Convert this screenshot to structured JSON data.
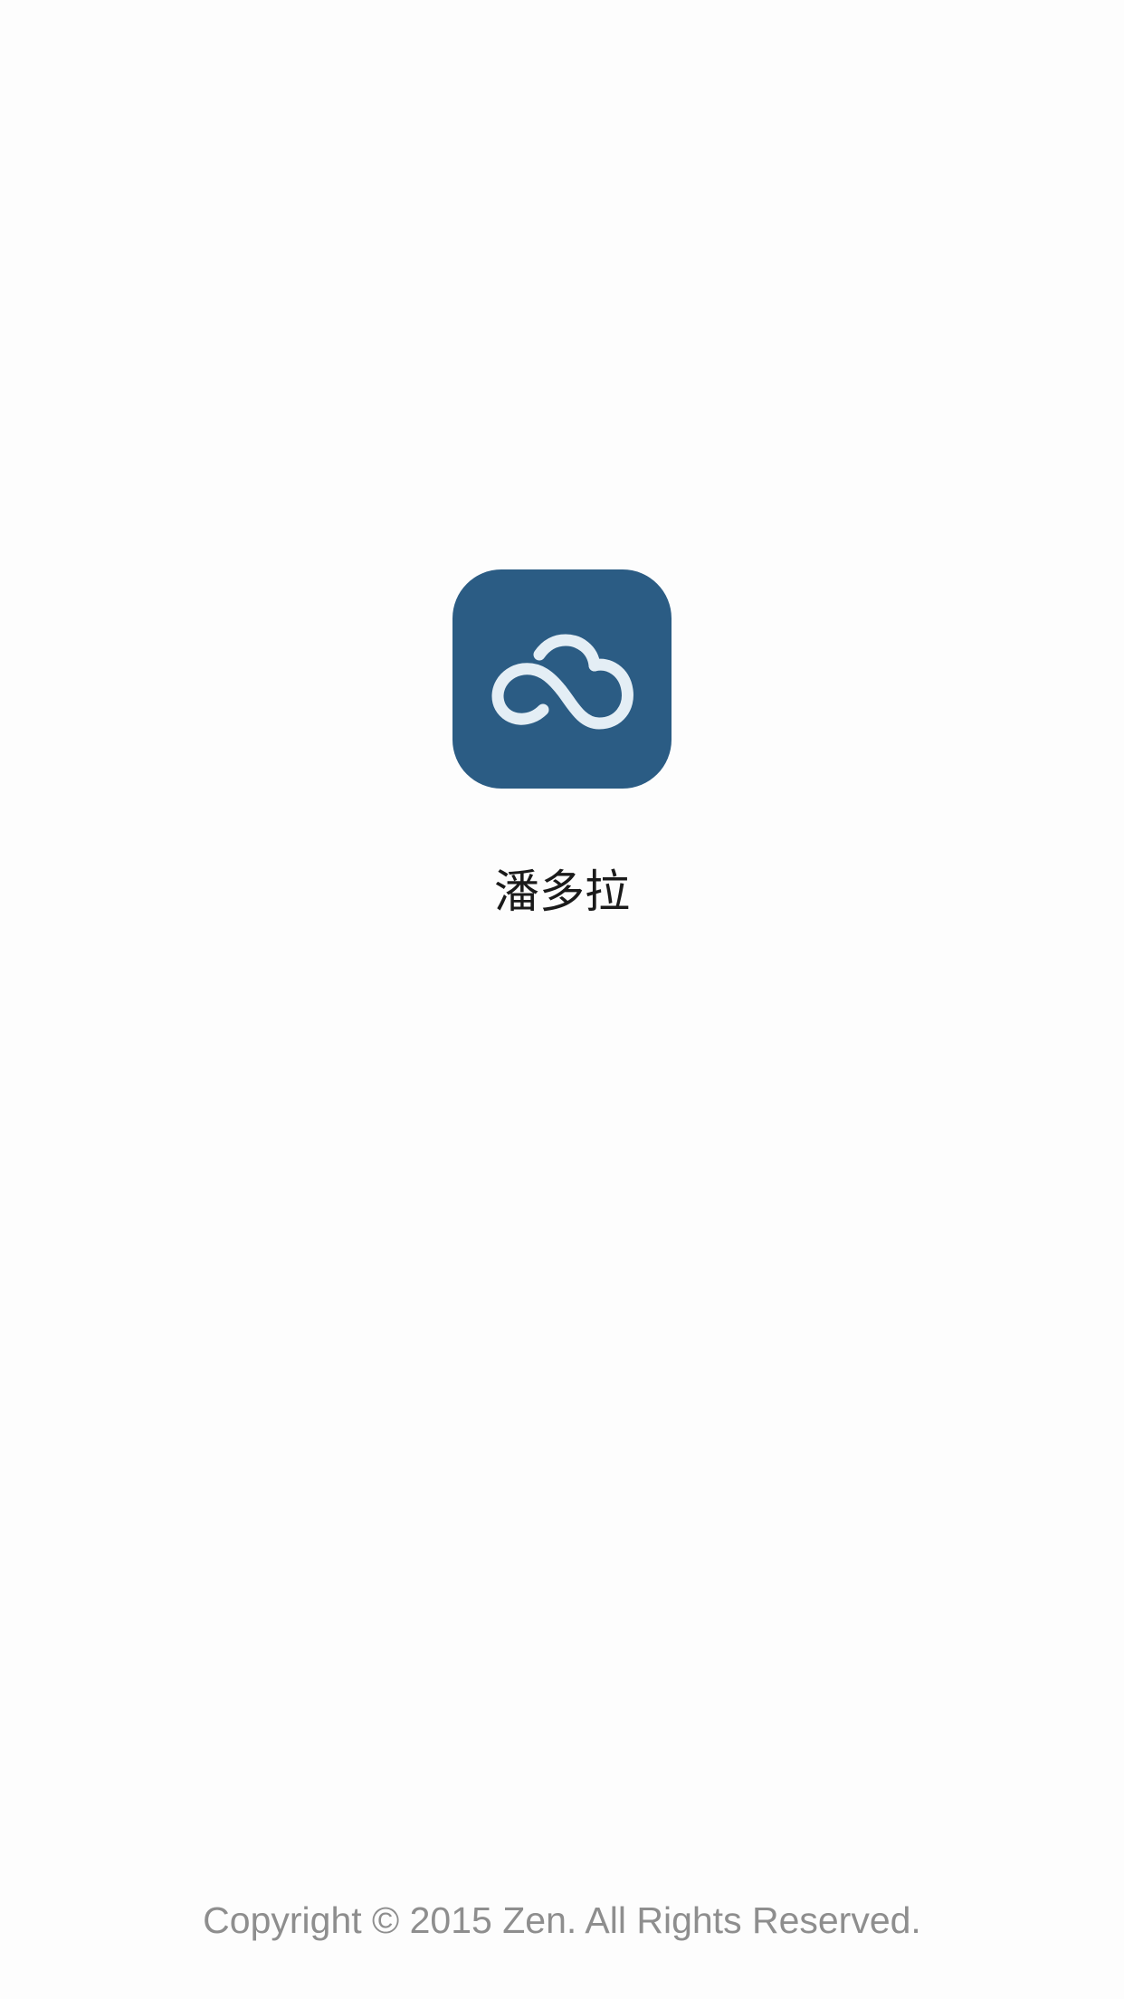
{
  "splash": {
    "logo_icon": "cloud-infinity-icon",
    "logo_color": "#2b5c84",
    "app_name": "潘多拉",
    "copyright": "Copyright © 2015 Zen. All Rights Reserved."
  }
}
